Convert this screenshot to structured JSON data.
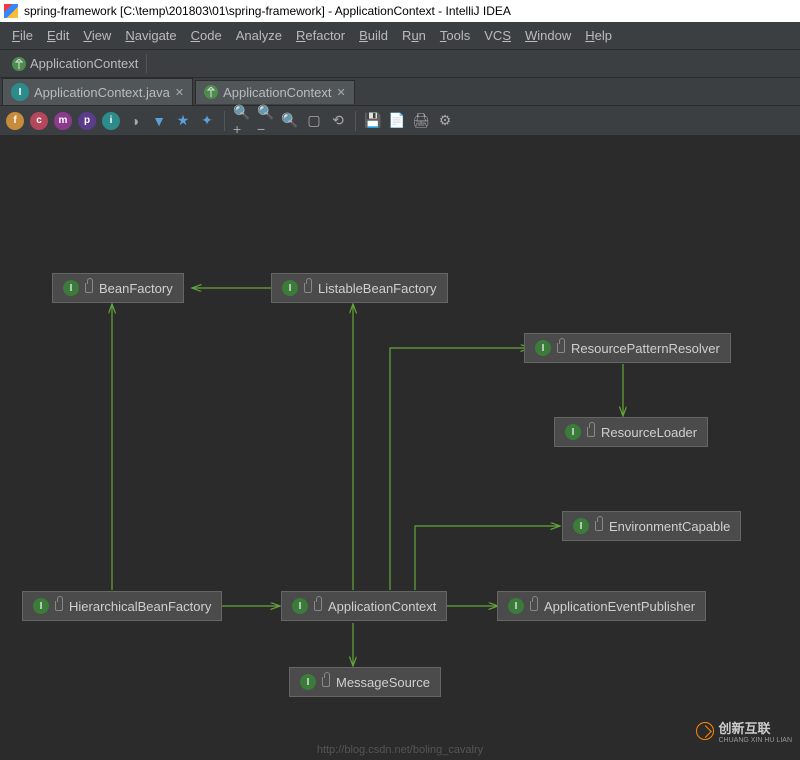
{
  "window": {
    "title": "spring-framework [C:\\temp\\201803\\01\\spring-framework] - ApplicationContext - IntelliJ IDEA"
  },
  "menu": {
    "file": "File",
    "edit": "Edit",
    "view": "View",
    "navigate": "Navigate",
    "code": "Code",
    "analyze": "Analyze",
    "refactor": "Refactor",
    "build": "Build",
    "run": "Run",
    "tools": "Tools",
    "vcs": "VCS",
    "window": "Window",
    "help": "Help"
  },
  "breadcrumb": {
    "item": "ApplicationContext"
  },
  "tabs": [
    {
      "label": "ApplicationContext.java"
    },
    {
      "label": "ApplicationContext"
    }
  ],
  "nodes": {
    "beanFactory": "BeanFactory",
    "listableBeanFactory": "ListableBeanFactory",
    "resourcePatternResolver": "ResourcePatternResolver",
    "resourceLoader": "ResourceLoader",
    "environmentCapable": "EnvironmentCapable",
    "hierarchicalBeanFactory": "HierarchicalBeanFactory",
    "applicationContext": "ApplicationContext",
    "applicationEventPublisher": "ApplicationEventPublisher",
    "messageSource": "MessageSource"
  },
  "watermark": {
    "url": "http://blog.csdn.net/boling_cavalry",
    "brand": "创新互联",
    "brand_sub": "CHUANG XIN HU LIAN"
  }
}
